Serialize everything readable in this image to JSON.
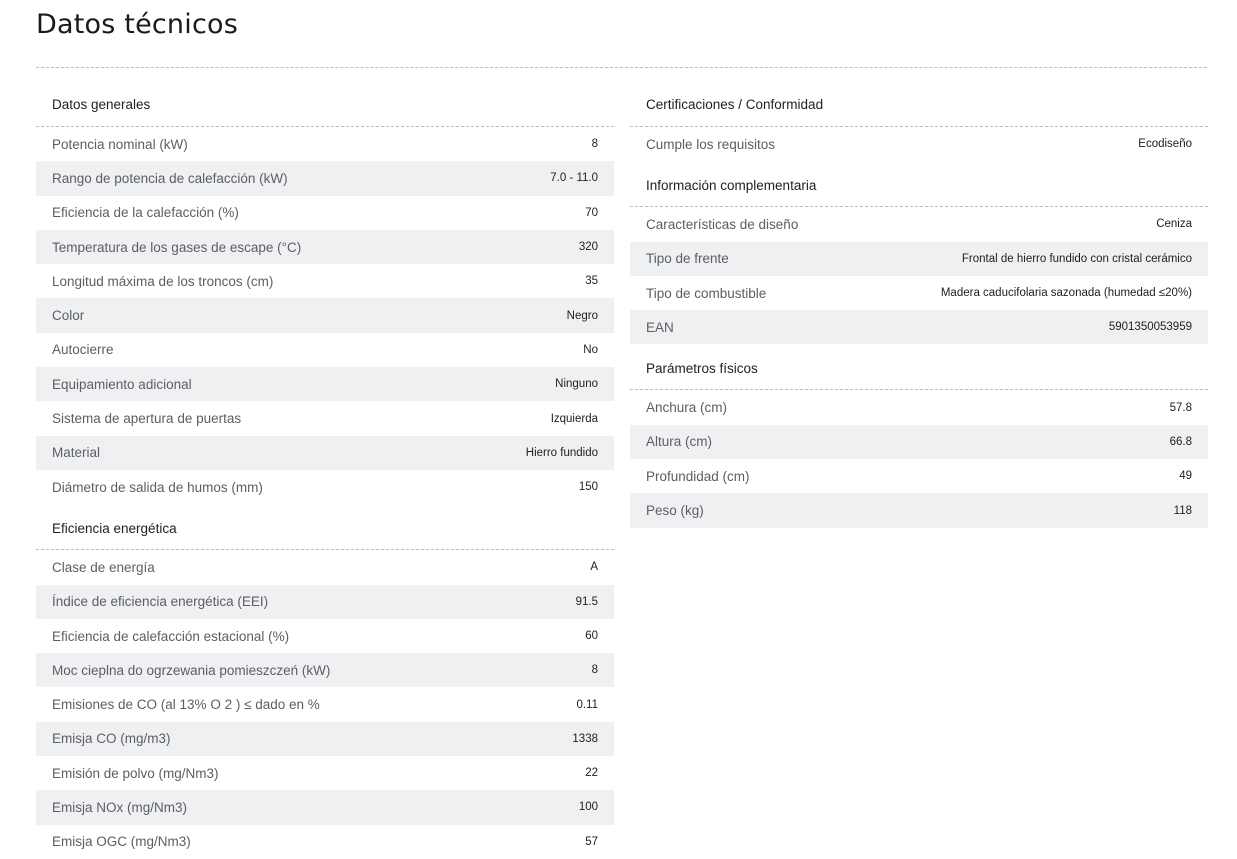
{
  "page": {
    "title": "Datos técnicos"
  },
  "left": {
    "general": {
      "heading": "Datos generales",
      "rows": [
        {
          "label": "Potencia nominal (kW)",
          "value": "8"
        },
        {
          "label": "Rango de potencia de calefacción (kW)",
          "value": "7.0 - 11.0"
        },
        {
          "label": "Eficiencia de la calefacción (%)",
          "value": "70"
        },
        {
          "label": "Temperatura de los gases de escape (°C)",
          "value": "320"
        },
        {
          "label": "Longitud máxima de los troncos (cm)",
          "value": "35"
        },
        {
          "label": "Color",
          "value": "Negro"
        },
        {
          "label": "Autocierre",
          "value": "No"
        },
        {
          "label": "Equipamiento adicional",
          "value": "Ninguno"
        },
        {
          "label": "Sistema de apertura de puertas",
          "value": "Izquierda"
        },
        {
          "label": "Material",
          "value": "Hierro fundido"
        },
        {
          "label": "Diámetro de salida de humos (mm)",
          "value": "150"
        }
      ]
    },
    "energy": {
      "heading": "Eficiencia energética",
      "rows": [
        {
          "label": "Clase de energía",
          "value": "A"
        },
        {
          "label": "Índice de eficiencia energética (EEI)",
          "value": "91.5"
        },
        {
          "label": "Eficiencia de calefacción estacional (%)",
          "value": "60"
        },
        {
          "label": "Moc cieplna do ogrzewania pomieszczeń (kW)",
          "value": "8"
        },
        {
          "label": "Emisiones de CO (al 13% O 2 ) ≤ dado en %",
          "value": "0.11"
        },
        {
          "label": "Emisja CO (mg/m3)",
          "value": "1338"
        },
        {
          "label": "Emisión de polvo (mg/Nm3)",
          "value": "22"
        },
        {
          "label": "Emisja NOx (mg/Nm3)",
          "value": "100"
        },
        {
          "label": "Emisja OGC (mg/Nm3)",
          "value": "57"
        }
      ]
    }
  },
  "right": {
    "certifications": {
      "heading": "Certificaciones / Conformidad",
      "rows": [
        {
          "label": "Cumple los requisitos",
          "value": "Ecodiseño"
        }
      ]
    },
    "complementary": {
      "heading": "Información complementaria",
      "rows": [
        {
          "label": "Características de diseño",
          "value": "Ceniza"
        },
        {
          "label": "Tipo de frente",
          "value": "Frontal de hierro fundido con cristal cerámico"
        },
        {
          "label": "Tipo de combustible",
          "value": "Madera caducifolaria sazonada (humedad ≤20%)"
        },
        {
          "label": "EAN",
          "value": "5901350053959"
        }
      ]
    },
    "physical": {
      "heading": "Parámetros físicos",
      "rows": [
        {
          "label": "Anchura (cm)",
          "value": "57.8"
        },
        {
          "label": "Altura (cm)",
          "value": "66.8"
        },
        {
          "label": "Profundidad (cm)",
          "value": "49"
        },
        {
          "label": "Peso (kg)",
          "value": "118"
        }
      ]
    }
  }
}
